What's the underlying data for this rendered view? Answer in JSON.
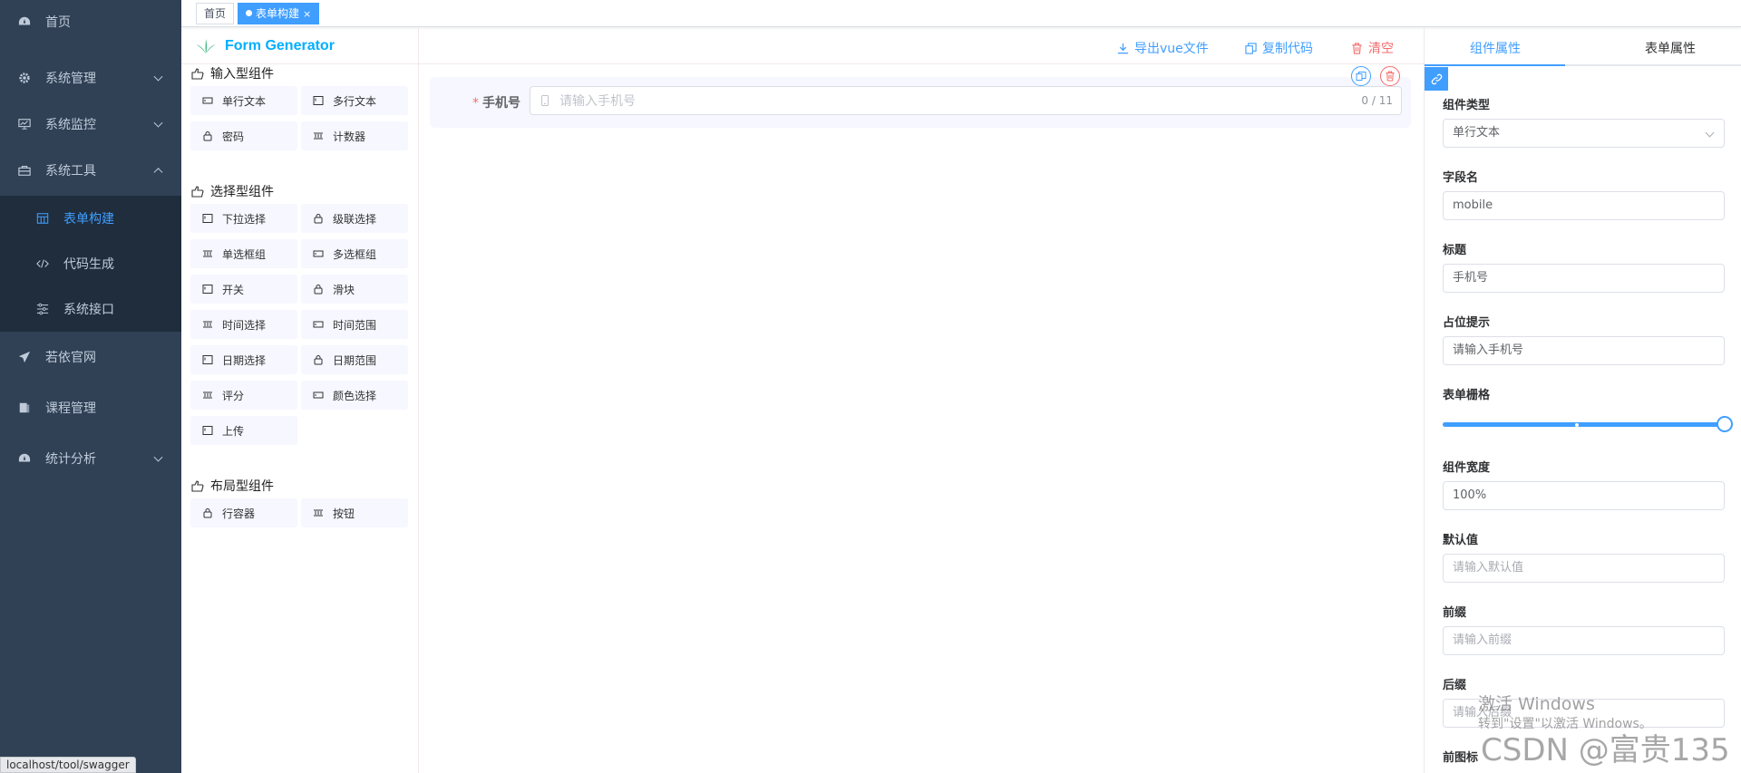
{
  "sidebar": {
    "items": [
      {
        "label": "首页",
        "icon": "dashboard-icon"
      },
      {
        "label": "系统管理",
        "icon": "system-icon"
      },
      {
        "label": "系统监控",
        "icon": "monitor-icon"
      },
      {
        "label": "系统工具",
        "icon": "tool-icon"
      },
      {
        "label": "若依官网",
        "icon": "guide-icon"
      },
      {
        "label": "课程管理",
        "icon": "course-icon"
      },
      {
        "label": "统计分析",
        "icon": "analysis-icon"
      }
    ],
    "sub_items": [
      {
        "label": "表单构建",
        "icon": "build-icon"
      },
      {
        "label": "代码生成",
        "icon": "code-icon"
      },
      {
        "label": "系统接口",
        "icon": "swagger-icon"
      }
    ],
    "status_url": "localhost/tool/swagger"
  },
  "tags": {
    "home": "首页",
    "active": "表单构建",
    "close_glyph": "×"
  },
  "left_panel": {
    "logo_text": "Form Generator",
    "groups": [
      {
        "title": "输入型组件",
        "items": [
          "单行文本",
          "多行文本",
          "密码",
          "计数器"
        ]
      },
      {
        "title": "选择型组件",
        "items": [
          "下拉选择",
          "级联选择",
          "单选框组",
          "多选框组",
          "开关",
          "滑块",
          "时间选择",
          "时间范围",
          "日期选择",
          "日期范围",
          "评分",
          "颜色选择",
          "上传"
        ]
      },
      {
        "title": "布局型组件",
        "items": [
          "行容器",
          "按钮"
        ]
      }
    ]
  },
  "toolbar": {
    "export_label": "导出vue文件",
    "copy_label": "复制代码",
    "clear_label": "清空"
  },
  "canvas": {
    "field": {
      "required_mark": "*",
      "label": "手机号",
      "placeholder": "请输入手机号",
      "counter": "0 / 11"
    }
  },
  "right_panel": {
    "tabs": [
      "组件属性",
      "表单属性"
    ],
    "fields": [
      {
        "label": "组件类型",
        "value": "单行文本",
        "type": "select"
      },
      {
        "label": "字段名",
        "value": "mobile",
        "type": "input"
      },
      {
        "label": "标题",
        "value": "手机号",
        "type": "input"
      },
      {
        "label": "占位提示",
        "value": "请输入手机号",
        "type": "input"
      },
      {
        "label": "表单栅格",
        "value": 24,
        "max": 24,
        "type": "slider"
      },
      {
        "label": "组件宽度",
        "value": "100%",
        "type": "input"
      },
      {
        "label": "默认值",
        "placeholder": "请输入默认值",
        "type": "input"
      },
      {
        "label": "前缀",
        "placeholder": "请输入前缀",
        "type": "input"
      },
      {
        "label": "后缀",
        "placeholder": "请输入后缀",
        "type": "input"
      },
      {
        "label": "前图标",
        "type": "label"
      }
    ]
  },
  "watermark": {
    "activate_title": "激活 Windows",
    "activate_sub": "转到\"设置\"以激活 Windows。",
    "csdn": "CSDN @富贵135"
  },
  "colors": {
    "sidebar_bg": "#304156",
    "submenu_bg": "#1f2d3d",
    "primary": "#409eff",
    "danger": "#f56c6c",
    "logo": "#00afff"
  }
}
